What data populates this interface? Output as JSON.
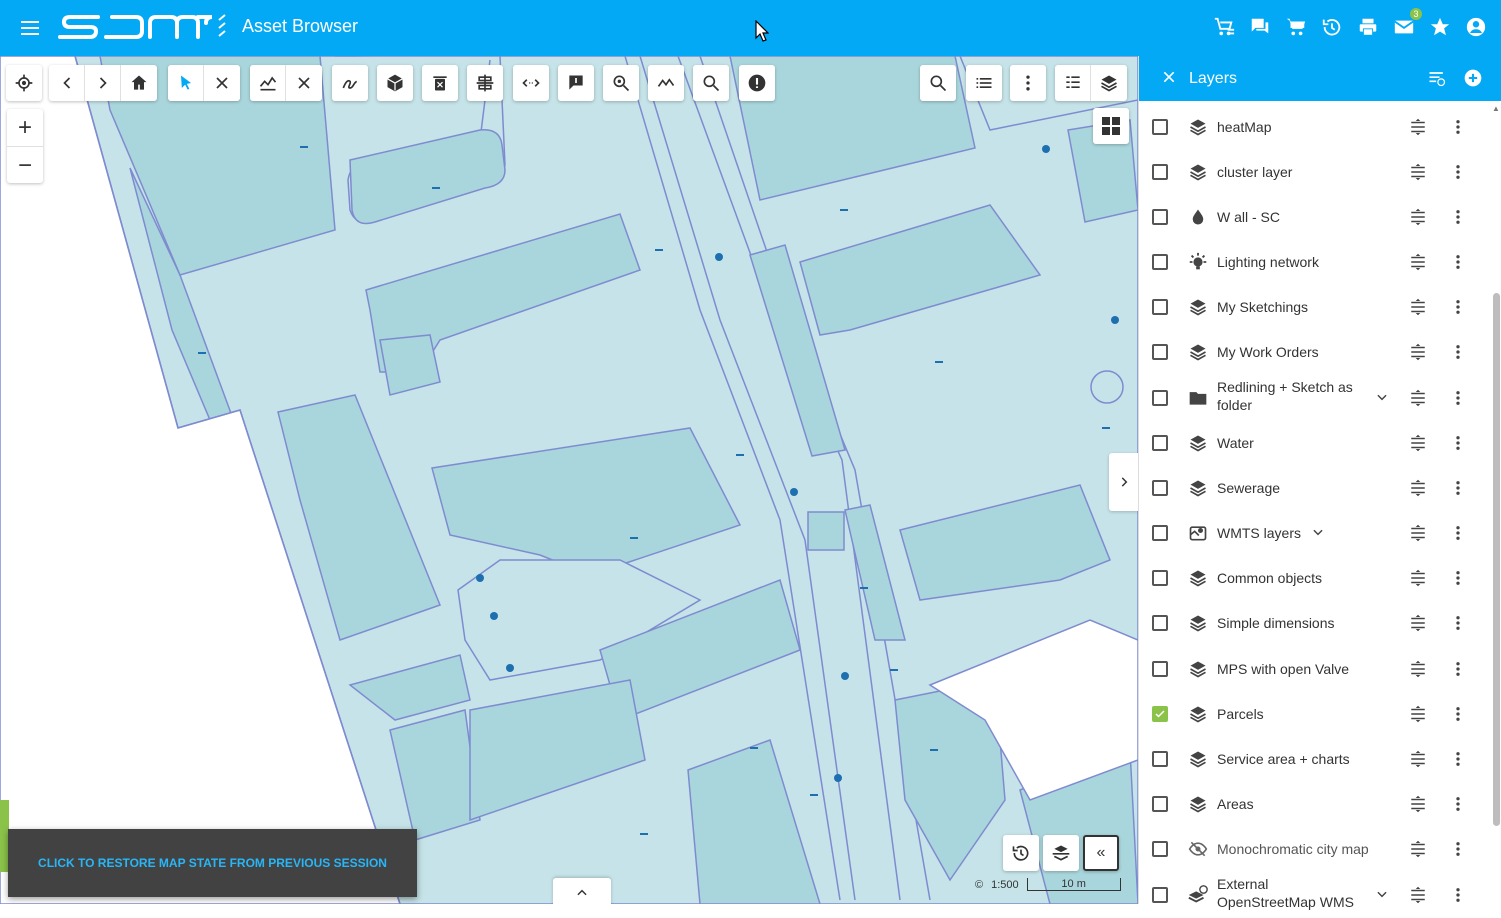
{
  "app": {
    "logo_text": "SAMO",
    "title": "Asset Browser",
    "message_badge": "3"
  },
  "top_icons": [
    "cart-list-icon",
    "chat-icon",
    "cart-icon",
    "history-icon",
    "print-icon",
    "mail-icon",
    "star-icon",
    "account-icon"
  ],
  "toolbar_groups": {
    "left": [
      "locate-icon",
      "back-icon",
      "forward-icon",
      "home-icon",
      "select-pointer-icon",
      "clear-select-icon",
      "chart-profile-icon",
      "clear-profile-icon",
      "sketch-icon",
      "add-object-icon",
      "delete-icon",
      "split-icon",
      "measure-icon",
      "report-icon",
      "zoom-search-icon",
      "line-tool-icon",
      "search-icon",
      "alert-icon"
    ],
    "right": [
      "search-icon",
      "list-icon",
      "more-icon",
      "legend-icon",
      "layers-icon"
    ]
  },
  "zoom": {
    "in": "+",
    "out": "−"
  },
  "scale": {
    "label": "1:500",
    "bar": "10 m",
    "copyright": "©"
  },
  "toast": {
    "text": "CLICK TO RESTORE MAP STATE FROM PREVIOUS SESSION"
  },
  "layers_panel": {
    "title": "Layers",
    "items": [
      {
        "name": "heatMap",
        "icon": "layer-stack-icon",
        "checked": false
      },
      {
        "name": "cluster layer",
        "icon": "layer-stack-icon",
        "checked": false
      },
      {
        "name": "W all - SC",
        "icon": "water-drop-icon",
        "checked": false
      },
      {
        "name": "Lighting network",
        "icon": "lightbulb-icon",
        "checked": false
      },
      {
        "name": "My Sketchings",
        "icon": "layer-stack-icon",
        "checked": false
      },
      {
        "name": "My Work Orders",
        "icon": "layer-stack-icon",
        "checked": false
      },
      {
        "name": "Redlining + Sketch as folder",
        "icon": "folder-icon",
        "checked": false,
        "expandable": true
      },
      {
        "name": "Water",
        "icon": "layer-stack-icon",
        "checked": false
      },
      {
        "name": "Sewerage",
        "icon": "layer-stack-icon",
        "checked": false
      },
      {
        "name": "WMTS layers",
        "icon": "wmts-icon",
        "checked": false,
        "expandable": true
      },
      {
        "name": "Common objects",
        "icon": "layer-stack-icon",
        "checked": false
      },
      {
        "name": "Simple dimensions",
        "icon": "layer-stack-icon",
        "checked": false
      },
      {
        "name": "MPS with open Valve",
        "icon": "layer-stack-icon",
        "checked": false
      },
      {
        "name": "Parcels",
        "icon": "layer-stack-icon",
        "checked": true
      },
      {
        "name": "Service area + charts",
        "icon": "layer-stack-icon",
        "checked": false
      },
      {
        "name": "Areas",
        "icon": "layer-stack-icon",
        "checked": false
      },
      {
        "name": "Monochromatic city map",
        "icon": "eye-off-icon",
        "checked": false
      },
      {
        "name": "External OpenStreetMap WMS",
        "icon": "external-layer-icon",
        "checked": false,
        "expandable": true
      }
    ]
  },
  "colors": {
    "brand": "#03a9f4",
    "parcel_fill": "#c5e3e8",
    "building_fill": "#a9d6dc",
    "outline": "#7f8bd0",
    "check": "#8bc34a",
    "toast_text": "#29b6f6"
  }
}
